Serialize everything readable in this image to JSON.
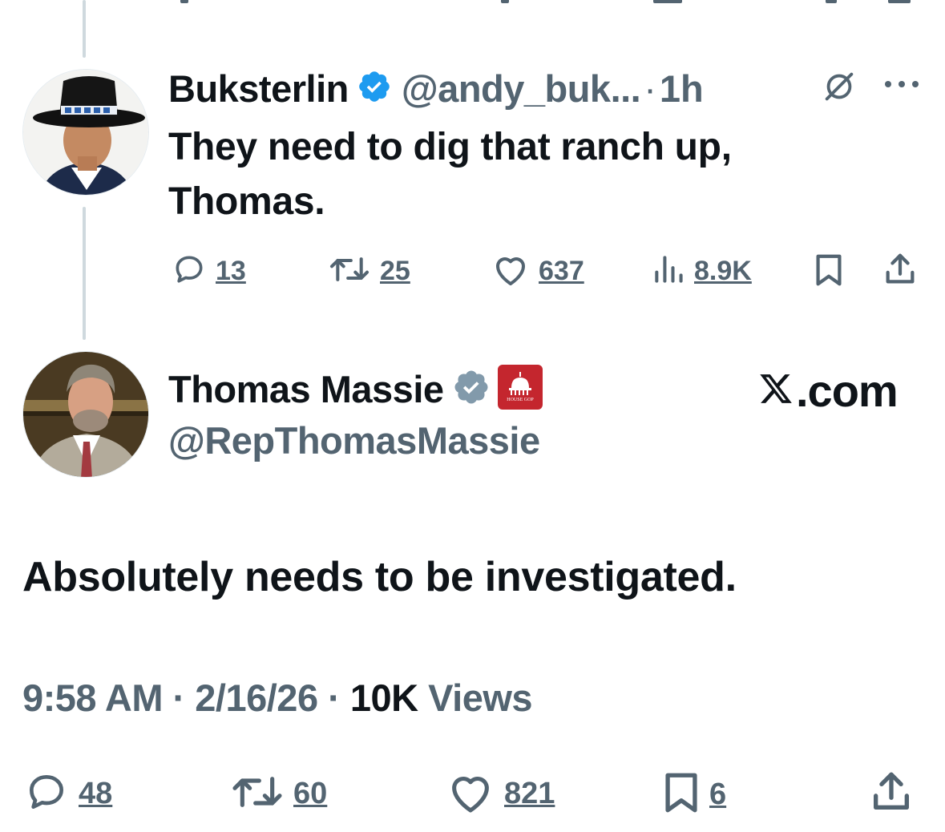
{
  "reply": {
    "name": "Buksterlin",
    "handle": "@andy_buk...",
    "separator": "·",
    "time": "1h",
    "text": "They need to dig that ranch up, Thomas.",
    "actions": {
      "replies": "13",
      "reposts": "25",
      "likes": "637",
      "views": "8.9K"
    }
  },
  "main": {
    "name": "Thomas Massie",
    "handle": "@RepThomasMassie",
    "badge_label": "HOUSE GOP",
    "source_brand": ".com",
    "text": "Absolutely needs to be investigated.",
    "meta": {
      "time": "9:58 AM",
      "sep1": "·",
      "date": "2/16/26",
      "sep2": "·",
      "views_count": "10K",
      "views_label": "Views"
    },
    "actions": {
      "replies": "48",
      "reposts": "60",
      "likes": "821",
      "bookmarks": "6"
    }
  },
  "colors": {
    "text": "#0f1419",
    "muted": "#536471",
    "verified_blue": "#1d9bf0",
    "verified_gray": "#829aab",
    "gop_red": "#c4262e",
    "thread_line": "#cfd9de"
  },
  "icons": [
    "reply-icon",
    "repost-icon",
    "like-icon",
    "views-icon",
    "bookmark-icon",
    "share-icon",
    "grok-icon",
    "more-icon",
    "verified-icon",
    "house-gop-badge",
    "x-logo-icon"
  ]
}
